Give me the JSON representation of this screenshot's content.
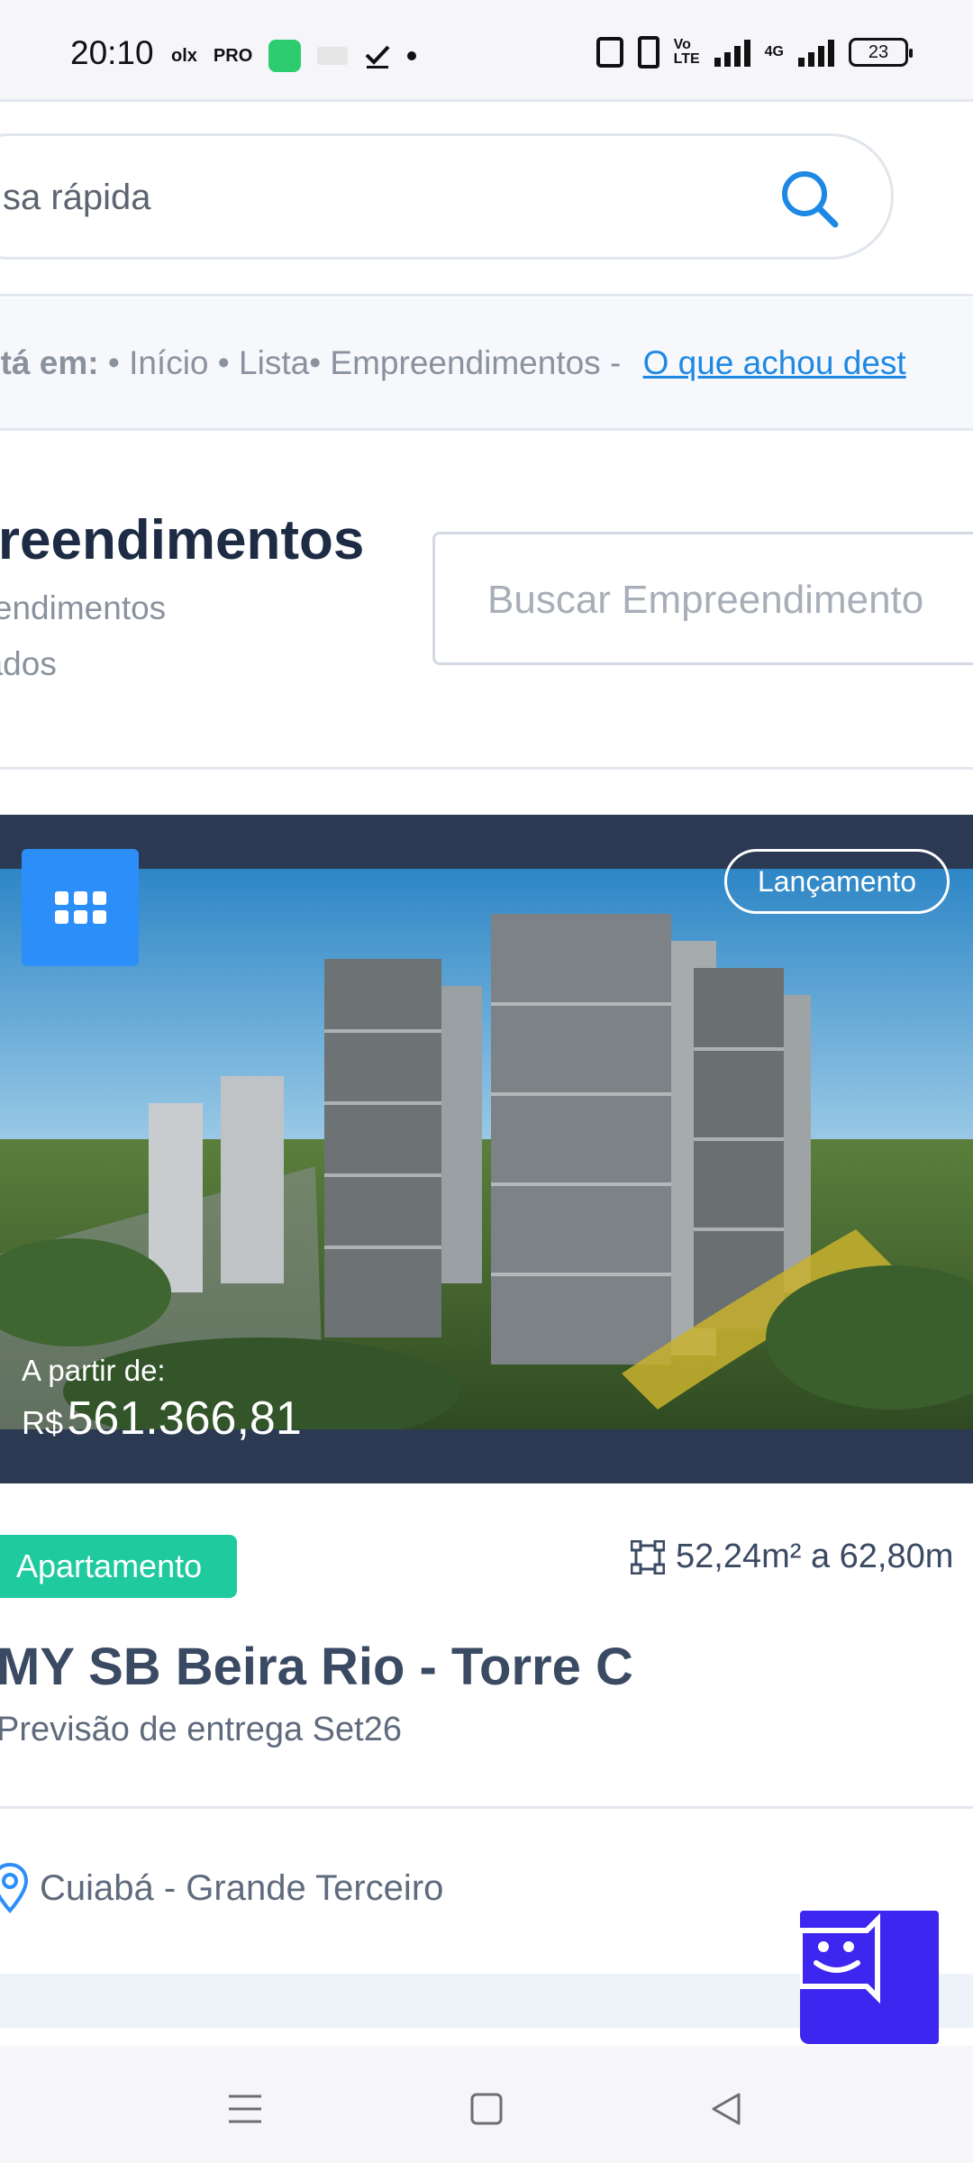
{
  "status_bar": {
    "time": "20:10",
    "left_icons": [
      "olx",
      "PRO"
    ],
    "network": "4G",
    "battery": "23"
  },
  "quick_search": {
    "text": "sa rápida"
  },
  "breadcrumb": {
    "prefix": "stá em:",
    "items": [
      "• Início",
      "• Lista",
      "• Empreendimentos -"
    ],
    "feedback_link": "O que achou dest"
  },
  "listing_header": {
    "title": "preendimentos",
    "subtitle": "reendimentos trados",
    "search_placeholder": "Buscar Empreendimento"
  },
  "card": {
    "badge": "Lançamento",
    "price_label": "A partir de:",
    "price_currency": "R$",
    "price_value": "561.366,81",
    "type": "Apartamento",
    "area": "52,24m² a 62,80m",
    "title": "MY SB Beira Rio - Torre C",
    "delivery": "Previsão de entrega Set26",
    "location": "Cuiabá - Grande Terceiro"
  },
  "colors": {
    "accent_blue": "#2c8ef8",
    "type_green": "#1fca9e",
    "chat_purple": "#3c26f0",
    "link_blue": "#1e88e5"
  },
  "icons": {
    "search": "search-icon",
    "gallery": "grid-icon",
    "area": "area-frame-icon",
    "location": "map-pin-icon",
    "chat": "chat-bot-icon"
  }
}
